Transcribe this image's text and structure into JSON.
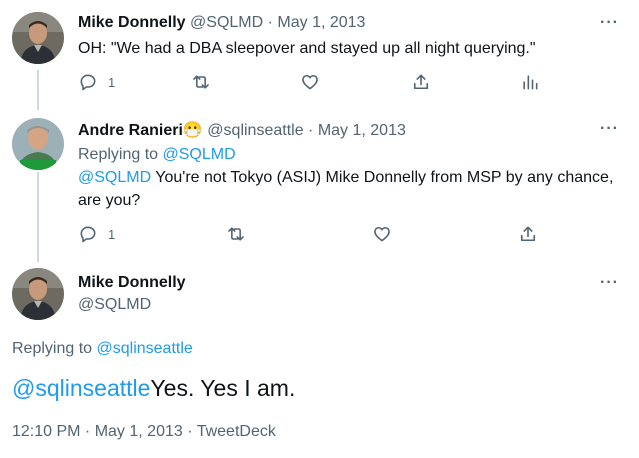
{
  "tweets": [
    {
      "name": "Mike Donnelly",
      "handle": "@SQLMD",
      "sep": " · ",
      "date": "May 1, 2013",
      "text": "OH: \"We had a DBA sleepover and stayed up all night querying.\"",
      "reply_count": "1"
    },
    {
      "name": "Andre Ranieri",
      "emoji": "😷",
      "handle": "@sqlinseattle",
      "sep": " · ",
      "date": "May 1, 2013",
      "replying_label": "Replying to ",
      "replying_to": "@SQLMD",
      "mention": "@SQLMD",
      "text_line1": " You're not Tokyo (ASIJ) Mike Donnelly from MSP by any chance,",
      "text_line2": "are you?",
      "reply_count": "1"
    }
  ],
  "main": {
    "name": "Mike Donnelly",
    "handle": "@SQLMD",
    "replying_label": "Replying to ",
    "replying_to": "@sqlinseattle",
    "mention": "@sqlinseattle",
    "text": "Yes. Yes I am.",
    "time": "12:10 PM",
    "sep1": " · ",
    "date": "May 1, 2013",
    "sep2": " · ",
    "source": "TweetDeck"
  },
  "more_label": "···",
  "colors": {
    "link": "#1d9bf0",
    "muted": "#536471",
    "text": "#0f1419",
    "line": "#cfd9de"
  }
}
